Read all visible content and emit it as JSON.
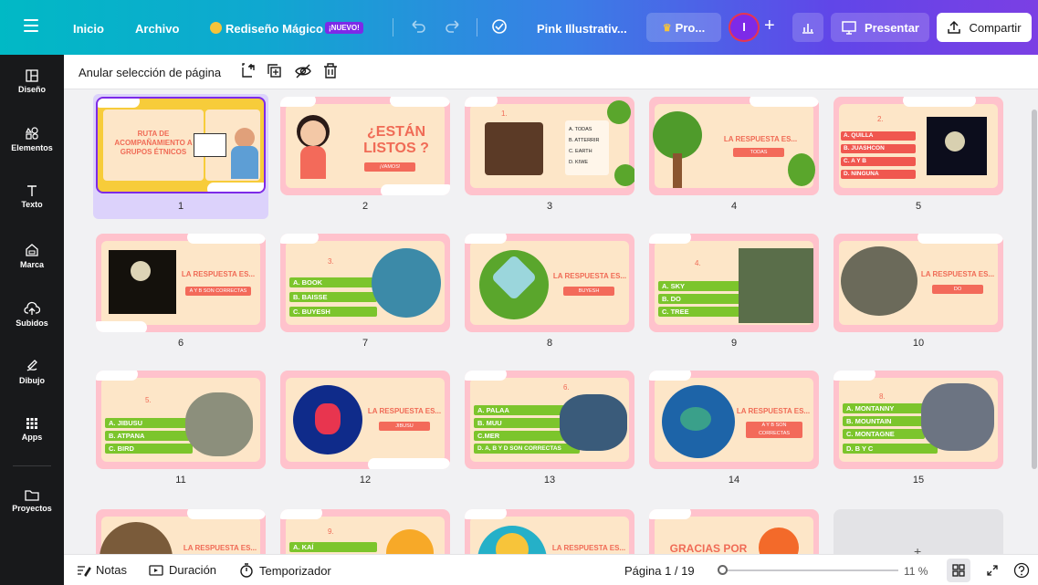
{
  "topbar": {
    "home": "Inicio",
    "file": "Archivo",
    "magic": "Rediseño Mágico",
    "new_badge": "¡NUEVO!",
    "doc_title": "Pink Illustrativ...",
    "pro": "Pro...",
    "avatar_letter": "I",
    "present": "Presentar",
    "share": "Compartir"
  },
  "sidebar": {
    "items": [
      {
        "label": "Diseño",
        "icon": "layout-icon"
      },
      {
        "label": "Elementos",
        "icon": "shapes-icon"
      },
      {
        "label": "Texto",
        "icon": "text-icon"
      },
      {
        "label": "Marca",
        "icon": "brand-icon"
      },
      {
        "label": "Subidos",
        "icon": "upload-icon"
      },
      {
        "label": "Dibujo",
        "icon": "draw-icon"
      },
      {
        "label": "Apps",
        "icon": "apps-icon"
      },
      {
        "label": "Proyectos",
        "icon": "folder-icon"
      }
    ]
  },
  "toolbar": {
    "deselect": "Anular selección de página"
  },
  "slides": {
    "s1": {
      "title": "RUTA DE ACOMPAÑAMIENTO A GRUPOS ÉTNICOS"
    },
    "s2": {
      "title": "¿ESTÁN LISTOS ?",
      "sub": "¡VAMOS!"
    },
    "s3": {
      "q": "1.",
      "a": "A. TODAS",
      "b": "B. ATTERRIR",
      "c": "C. EARTH",
      "d": "D. KIWE"
    },
    "s4": {
      "title": "LA RESPUESTA ES...",
      "answer": "TODAS"
    },
    "s5": {
      "q": "2.",
      "a": "A. QUILLA",
      "b": "B. JUASHCON",
      "c": "C. A Y B",
      "d": "D. NINGUNA"
    },
    "s6": {
      "title": "LA RESPUESTA ES...",
      "answer": "A Y B SON CORRECTAS"
    },
    "s7": {
      "q": "3.",
      "a": "A. BOOK",
      "b": "B. BAISSE",
      "c": "C. BUYESH"
    },
    "s8": {
      "title": "LA RESPUESTA ES...",
      "answer": "BUYESH"
    },
    "s9": {
      "q": "4.",
      "a": "A. SKY",
      "b": "B. DO",
      "c": "C. TREE"
    },
    "s10": {
      "title": "LA RESPUESTA ES...",
      "answer": "DO"
    },
    "s11": {
      "q": "5.",
      "a": "A. JIBUSU",
      "b": "B. ATPANA",
      "c": "C. BIRD"
    },
    "s12": {
      "title": "LA RESPUESTA ES...",
      "answer": "JIBUSU"
    },
    "s13": {
      "q": "6.",
      "a": "A. PALAA",
      "b": "B. MUU",
      "c": "C.MER",
      "d": "D. A, B Y D SON CORRECTAS"
    },
    "s14": {
      "title": "LA RESPUESTA ES...",
      "answer": "A Y B SON CORRECTAS"
    },
    "s15": {
      "q": "8.",
      "a": "A. MONTANNY",
      "b": "B. MOUNTAIN",
      "c": "C. MONTAGNE",
      "d": "D. B Y C"
    },
    "s16": {
      "title": "LA RESPUESTA ES..."
    },
    "s17": {
      "q": "9.",
      "a": "A. KAÍ"
    },
    "s18": {
      "title": "LA RESPUESTA ES..."
    },
    "s19": {
      "title": "GRACIAS POR"
    }
  },
  "numbers": [
    "1",
    "2",
    "3",
    "4",
    "5",
    "6",
    "7",
    "8",
    "9",
    "10",
    "11",
    "12",
    "13",
    "14",
    "15"
  ],
  "bottombar": {
    "notes": "Notas",
    "duration": "Duración",
    "timer": "Temporizador",
    "page": "Página 1 / 19",
    "zoom": "11 %"
  }
}
